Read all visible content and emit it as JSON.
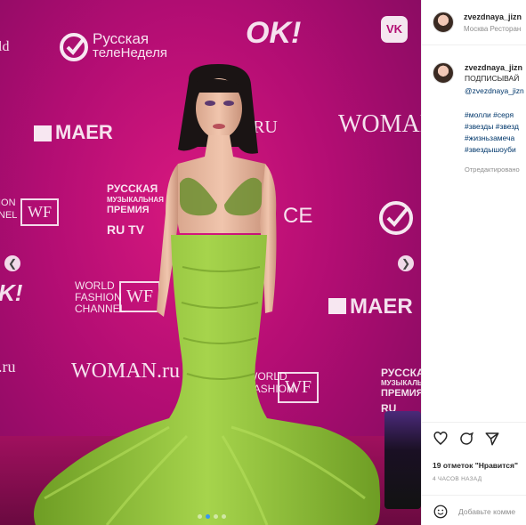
{
  "photo": {
    "backdrop_logos": {
      "russkaya_line1": "Русская",
      "russkaya_line2": "телеНеделя",
      "ok": "OK!",
      "maer": "MAER",
      "maer2": "MAER",
      "woman": "WOMAN",
      "woman_ru": "WOMAN.ru",
      "ru_partial": "RU",
      "award_line1": "РУССКАЯ",
      "award_line2": "МУЗЫКАЛЬНАЯ",
      "award_line3": "ПРЕМИЯ",
      "award_line4": "RU TV",
      "award2_line1": "РУССКАЯ",
      "award2_line2": "МУЗЫКАЛЬНАЯ",
      "award2_line3": "ПРЕМИЯ",
      "award2_line4": "RU",
      "wf": "WF",
      "wf2": "WF",
      "wf3": "WF",
      "world_fashion_line1": "WORLD",
      "world_fashion_line2": "FASHION",
      "world_fashion_line3": "CHANNEL",
      "world_fashion_left_line1": "ION",
      "world_fashion_left_line2": "NEL",
      "world_partial_line1": "WORLD",
      "world_partial_line2": "FASHION",
      "ce": "CE",
      "ok_left": "K!",
      "ru_left": ".ru",
      "ld": "ld"
    },
    "carousel": {
      "active_index": 1,
      "count": 4
    }
  },
  "header": {
    "username": "zvezdnaya_jizn",
    "location": "Москва Ресторан"
  },
  "caption": {
    "username": "zvezdnaya_jizn",
    "line1": "ПОДПИСЫВАЙ",
    "mention": "@zvezdnaya_jizn",
    "hashtags": [
      "#молли #серя",
      "#звезды #звезд",
      "#жизньзамеча",
      "#звездышоуби"
    ],
    "edited": "Отредактировано"
  },
  "actions": {
    "likes": "19 отметок \"Нравится\"",
    "time": "4 ЧАСОВ НАЗАД",
    "comment_placeholder": "Добавьте комме"
  },
  "colors": {
    "backdrop": "#b20d73",
    "dress": "#8fc23a",
    "link": "#00376b",
    "active_dot": "#3897f0"
  }
}
